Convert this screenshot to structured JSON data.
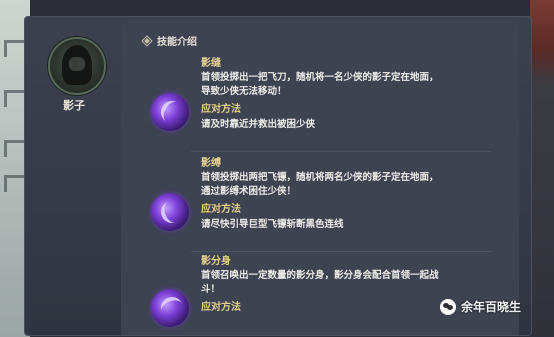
{
  "character": {
    "name": "影子"
  },
  "section": {
    "title": "技能介绍"
  },
  "skills": [
    {
      "name": "影缝",
      "desc_lines": [
        "首领投掷出一把飞刀，随机将一名少侠的影子定在地面，",
        "导致少侠无法移动！"
      ],
      "method_title": "应对方法",
      "method_desc": "请及时靠近并救出被困少侠",
      "icon": "shadow-stitch-icon"
    },
    {
      "name": "影缚",
      "desc_lines": [
        "首领投掷出两把飞镖，随机将两名少侠的影子定在地面，",
        "通过影缚术困住少侠！"
      ],
      "method_title": "应对方法",
      "method_desc": "请尽快引导巨型飞镖斩断黑色连线",
      "icon": "shadow-bind-icon"
    },
    {
      "name": "影分身",
      "desc_lines": [
        "首领召唤出一定数量的影分身，影分身会配合首领一起战",
        "斗！"
      ],
      "method_title": "应对方法",
      "method_desc": "",
      "icon": "shadow-clone-icon"
    }
  ],
  "watermark": {
    "text": "余年百晓生"
  },
  "colors": {
    "accent": "#e3cf8d",
    "panel": "#3e4352",
    "skill_glow": "#7c40d8"
  }
}
